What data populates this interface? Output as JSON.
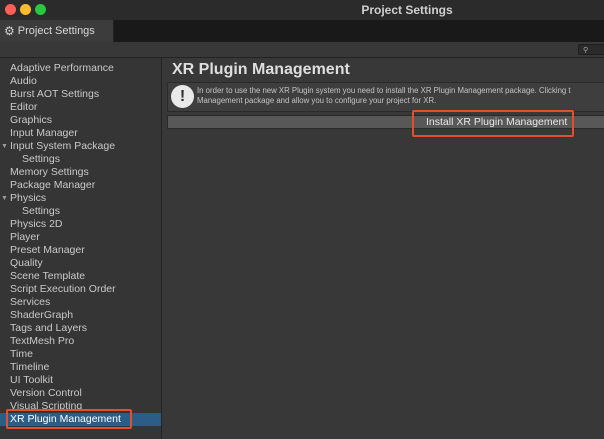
{
  "window": {
    "title": "Project Settings"
  },
  "tab": {
    "label": "Project Settings",
    "icon": "gear-icon"
  },
  "search": {
    "placeholder": "ὐD",
    "icon": "search-icon"
  },
  "sidebar": {
    "items": [
      {
        "label": "Adaptive Performance"
      },
      {
        "label": "Audio"
      },
      {
        "label": "Burst AOT Settings"
      },
      {
        "label": "Editor"
      },
      {
        "label": "Graphics"
      },
      {
        "label": "Input Manager"
      },
      {
        "label": "Input System Package",
        "expanded": true
      },
      {
        "label": "Settings",
        "child": true
      },
      {
        "label": "Memory Settings"
      },
      {
        "label": "Package Manager"
      },
      {
        "label": "Physics",
        "expanded": true
      },
      {
        "label": "Settings",
        "child": true
      },
      {
        "label": "Physics 2D"
      },
      {
        "label": "Player"
      },
      {
        "label": "Preset Manager"
      },
      {
        "label": "Quality"
      },
      {
        "label": "Scene Template"
      },
      {
        "label": "Script Execution Order"
      },
      {
        "label": "Services"
      },
      {
        "label": "ShaderGraph"
      },
      {
        "label": "Tags and Layers"
      },
      {
        "label": "TextMesh Pro"
      },
      {
        "label": "Time"
      },
      {
        "label": "Timeline"
      },
      {
        "label": "UI Toolkit"
      },
      {
        "label": "Version Control"
      },
      {
        "label": "Visual Scripting"
      },
      {
        "label": "XR Plugin Management",
        "selected": true
      }
    ]
  },
  "main": {
    "title": "XR Plugin Management",
    "help": {
      "icon": "info-icon",
      "icon_glyph": "!",
      "line1": "In order to use the new XR Plugin system you need to install the XR Plugin Management package. Clicking t",
      "line2": "Management package and allow you to configure your project for XR."
    },
    "install_button": "Install XR Plugin Management"
  },
  "colors": {
    "accent_selection": "#2c5d87",
    "highlight_outline": "#e0502e"
  }
}
